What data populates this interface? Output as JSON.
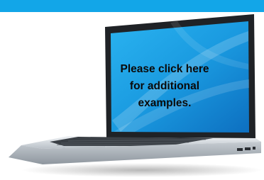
{
  "colors": {
    "top_bar": "#12a6e8",
    "screen_blue": "#1a9ae0",
    "laptop_silver": "#d8dde2",
    "laptop_dark": "#2b2f33"
  },
  "icons": {
    "illustration": "laptop-icon"
  },
  "call_to_action": {
    "lines": [
      "Please click here",
      "for additional",
      "examples."
    ]
  }
}
